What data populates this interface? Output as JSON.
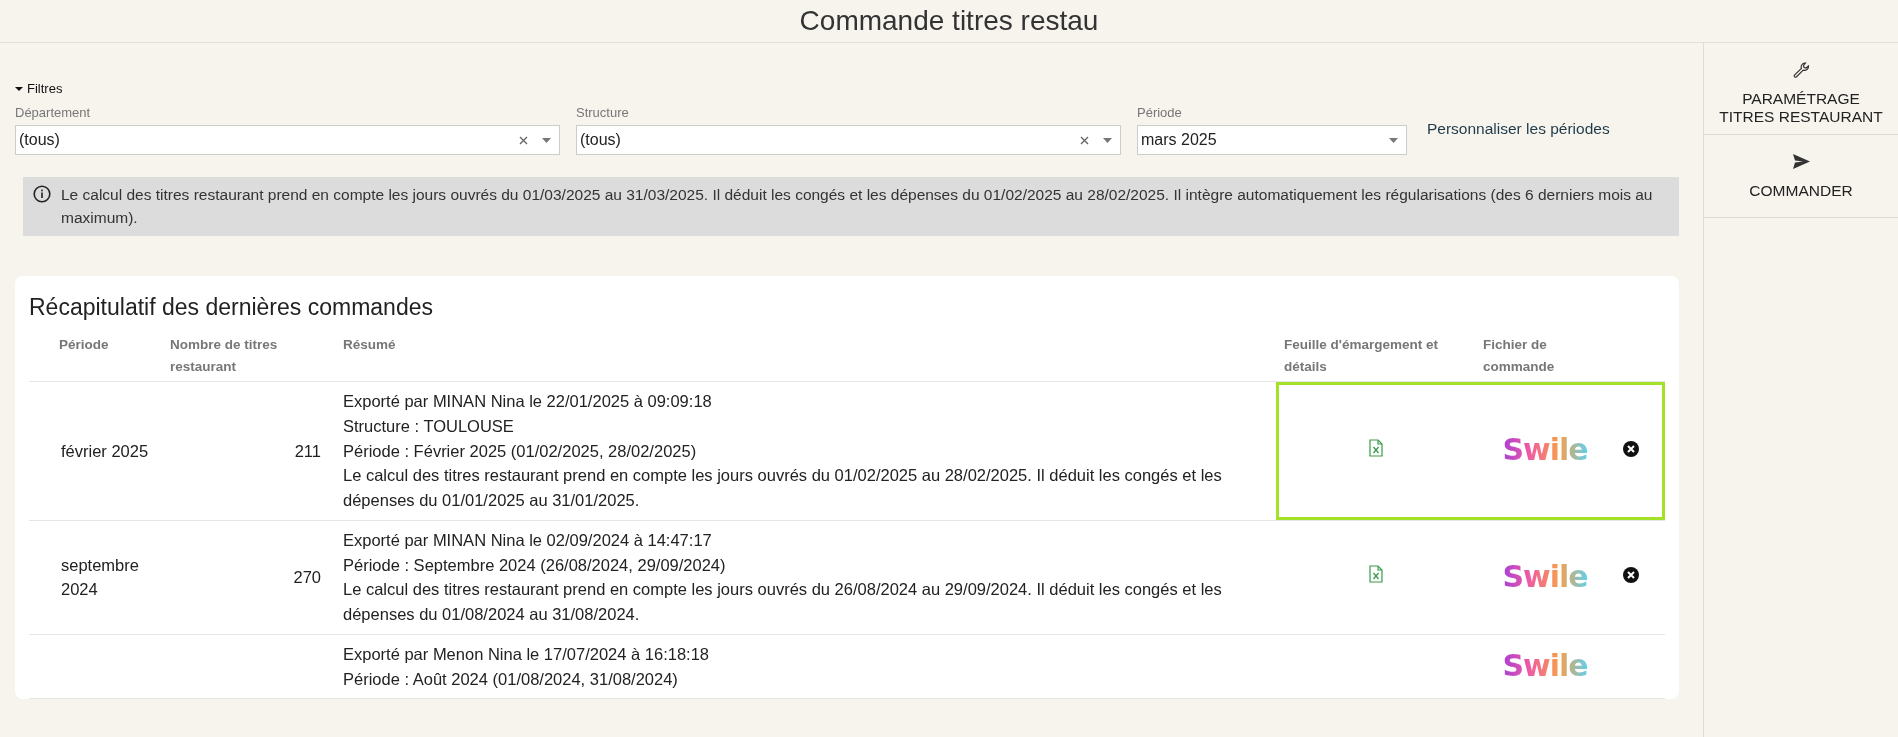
{
  "header": {
    "title": "Commande titres restau"
  },
  "filters": {
    "toggle_label": "Filtres",
    "expanded": true,
    "fields": [
      {
        "label": "Département",
        "value": "(tous)",
        "clearable": true
      },
      {
        "label": "Structure",
        "value": "(tous)",
        "clearable": true
      },
      {
        "label": "Période",
        "value": "mars 2025",
        "clearable": false
      }
    ],
    "custom_periods_link": "Personnaliser les périodes"
  },
  "info": "Le calcul des titres restaurant prend en compte les jours ouvrés du 01/03/2025 au 31/03/2025. Il déduit les congés et les dépenses du 01/02/2025 au 28/02/2025. Il intègre automatiquement les régularisations (des 6 derniers mois au maximum).",
  "summary": {
    "title": "Récapitulatif des dernières commandes",
    "columns": [
      "Période",
      "Nombre de titres restaurant",
      "Résumé",
      "Feuille d'émargement et détails",
      "Fichier de commande"
    ],
    "rows": [
      {
        "period": "février 2025",
        "count": "211",
        "lines": [
          "Exporté par MINAN Nina le 22/01/2025 à 09:09:18",
          "Structure : TOULOUSE",
          "Période : Février 2025 (01/02/2025, 28/02/2025)",
          "Le calcul des titres restaurant prend en compte les jours ouvrés du 01/02/2025 au 28/02/2025. Il déduit les congés et les dépenses du 01/01/2025 au 31/01/2025."
        ],
        "sheet": true,
        "logo": "Swile",
        "delete": true,
        "highlighted": true
      },
      {
        "period": "septembre 2024",
        "count": "270",
        "lines": [
          "Exporté par MINAN Nina le 02/09/2024 à 14:47:17",
          "Période : Septembre 2024 (26/08/2024, 29/09/2024)",
          "Le calcul des titres restaurant prend en compte les jours ouvrés du 26/08/2024 au 29/09/2024. Il déduit les congés et les dépenses du 01/08/2024 au 31/08/2024."
        ],
        "sheet": true,
        "logo": "Swile",
        "delete": true,
        "highlighted": false
      },
      {
        "lines": [
          "Exporté par Menon Nina le 17/07/2024 à 16:18:18",
          "Période : Août 2024 (01/08/2024, 31/08/2024)"
        ],
        "sheet": false,
        "logo": "Swile",
        "delete": false,
        "highlighted": false
      }
    ]
  },
  "sidebar": {
    "items": [
      {
        "kind": "settings",
        "label": "PARAMÉTRAGE TITRES RESTAURANT"
      },
      {
        "kind": "order",
        "label": "COMMANDER"
      }
    ]
  }
}
